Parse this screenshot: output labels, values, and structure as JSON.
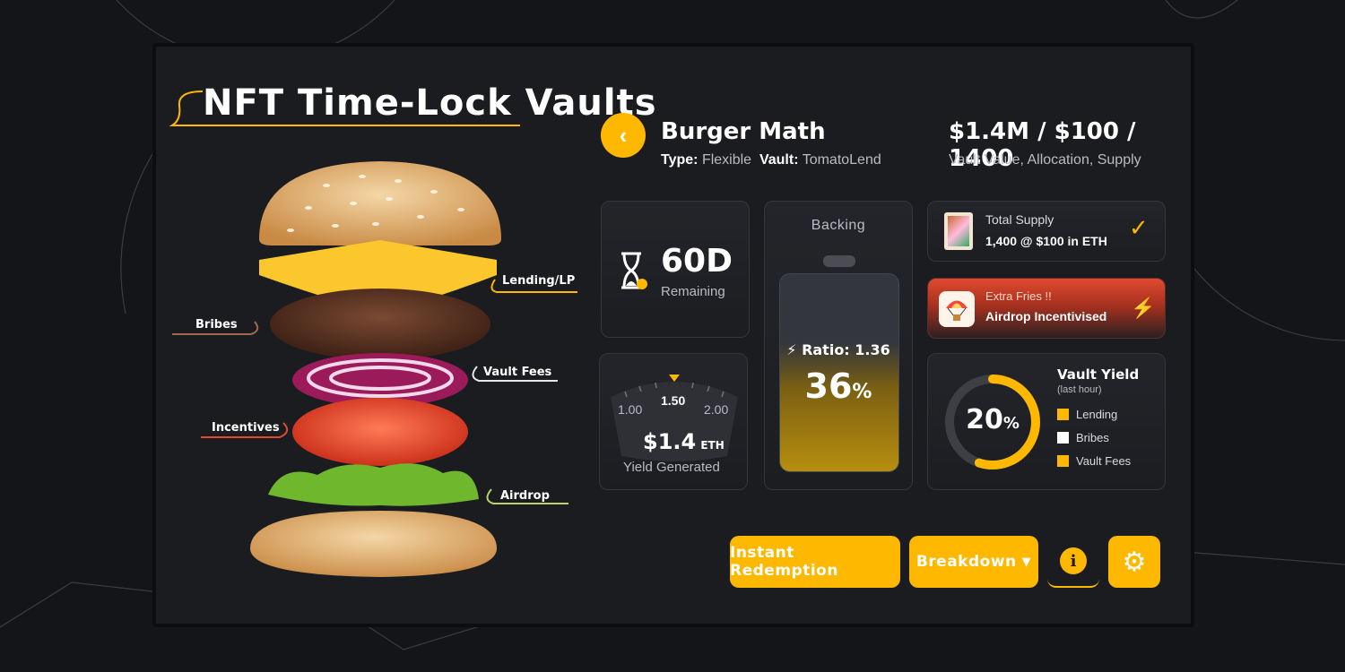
{
  "title": "NFT Time-Lock Vaults",
  "vault": {
    "name": "Burger Math",
    "type_key": "Type:",
    "type_val": "Flexible",
    "vault_key": "Vault:",
    "vault_val": "TomatoLend",
    "summary": "$1.4M / $100 / 1400",
    "summary_caption": "Vault Value, Allocation, Supply"
  },
  "layers": {
    "lending": "Lending/LP",
    "bribes": "Bribes",
    "vault_fees": "Vault Fees",
    "incentives": "Incentives",
    "airdrop": "Airdrop"
  },
  "remaining": {
    "value": "60D",
    "label": "Remaining"
  },
  "yield_gauge": {
    "min": "1.00",
    "mid": "1.50",
    "max": "2.00",
    "amount": "$1.4",
    "unit": "ETH",
    "label": "Yield Generated"
  },
  "backing": {
    "title": "Backing",
    "ratio": "Ratio: 1.36",
    "percent": "36",
    "percent_sign": "%",
    "fill": 0.36
  },
  "supply": {
    "title": "Total Supply",
    "detail": "1,400 @ $100 in ETH"
  },
  "promo": {
    "title": "Extra Fries !!",
    "detail": "Airdrop Incentivised"
  },
  "vault_yield": {
    "title": "Vault Yield",
    "subtitle": "(last hour)",
    "percent": "20",
    "percent_sign": "%",
    "fraction": 0.55,
    "legend": [
      {
        "label": "Lending",
        "color": "#ffb800"
      },
      {
        "label": "Bribes",
        "color": "#ffffff"
      },
      {
        "label": "Vault Fees",
        "color": "#ffb800"
      }
    ]
  },
  "actions": {
    "redeem": "Instant Redemption",
    "breakdown": "Breakdown"
  },
  "colors": {
    "accent": "#ffb800",
    "promo_start": "#d9432f",
    "promo_end": "#2a1d1d"
  }
}
